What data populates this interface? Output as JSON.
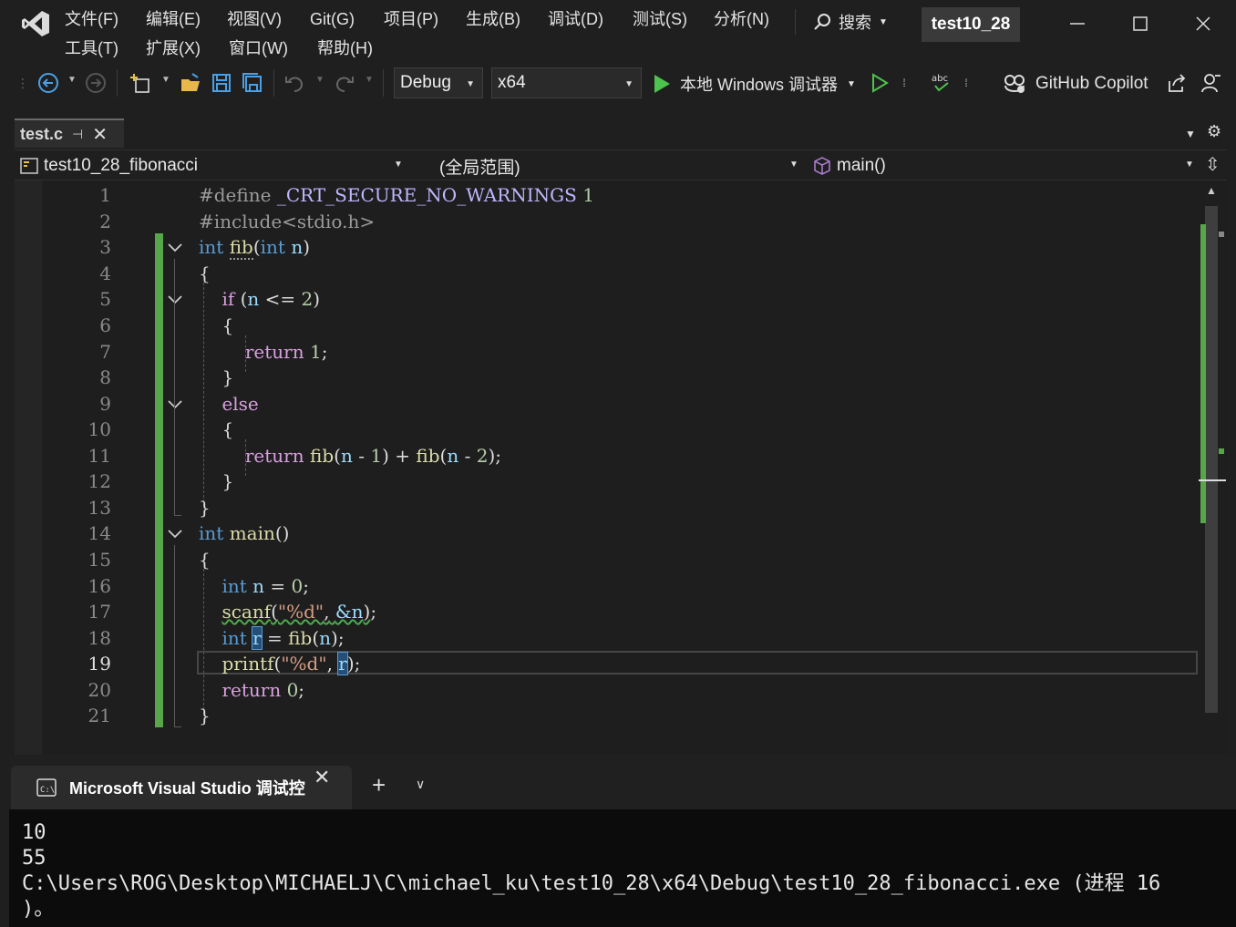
{
  "menu": {
    "file": "文件(F)",
    "edit": "编辑(E)",
    "view": "视图(V)",
    "git": "Git(G)",
    "project": "项目(P)",
    "build": "生成(B)",
    "debug": "调试(D)",
    "test": "测试(S)",
    "analyze": "分析(N)",
    "tools": "工具(T)",
    "extensions": "扩展(X)",
    "window": "窗口(W)",
    "help": "帮助(H)"
  },
  "search": {
    "label": "搜索"
  },
  "solution_name": "test10_28",
  "toolbar": {
    "configuration": "Debug",
    "platform": "x64",
    "run_label": "本地 Windows 调试器",
    "copilot_label": "GitHub Copilot"
  },
  "document_tab": {
    "name": "test.c"
  },
  "navbar": {
    "project": "test10_28_fibonacci",
    "scope": "(全局范围)",
    "member": "main()"
  },
  "editor": {
    "current_line": 19,
    "line_numbers": [
      "1",
      "2",
      "3",
      "4",
      "5",
      "6",
      "7",
      "8",
      "9",
      "10",
      "11",
      "12",
      "13",
      "14",
      "15",
      "16",
      "17",
      "18",
      "19",
      "20",
      "21"
    ],
    "tokens": {
      "l1_pp": "#define",
      "l1_macro": "_CRT_SECURE_NO_WARNINGS",
      "l1_val": "1",
      "l2_pp": "#include",
      "l2_hdr": "<stdio.h>",
      "kw_int": "int",
      "fn_fib": "fib",
      "p_open": "(",
      "p_close": ")",
      "var_n": "n",
      "brace_open": "{",
      "brace_close": "}",
      "kw_if": "if",
      "op_le": "<=",
      "num_0": "0",
      "num_1": "1",
      "num_2": "2",
      "kw_return": "return",
      "kw_else": "else",
      "op_minus": "-",
      "op_plus": "+",
      "op_assign": "=",
      "semi": ";",
      "comma": ",",
      "fn_main": "main",
      "fn_scanf": "scanf",
      "fn_printf": "printf",
      "str_fmt": "\"%d\"",
      "amp_n": "&n",
      "var_r": "r"
    }
  },
  "console": {
    "tab_title": "Microsoft Visual Studio 调试控",
    "lines": [
      "10",
      "55",
      "C:\\Users\\ROG\\Desktop\\MICHAELJ\\C\\michael_ku\\test10_28\\x64\\Debug\\test10_28_fibonacci.exe (进程 16",
      ")。"
    ]
  },
  "colors": {
    "keyword": "#569cd6",
    "function": "#dcdcaa",
    "number": "#b5cea8",
    "string": "#d69d85",
    "change_bar": "#57a64a",
    "run_green": "#4ec24e"
  }
}
